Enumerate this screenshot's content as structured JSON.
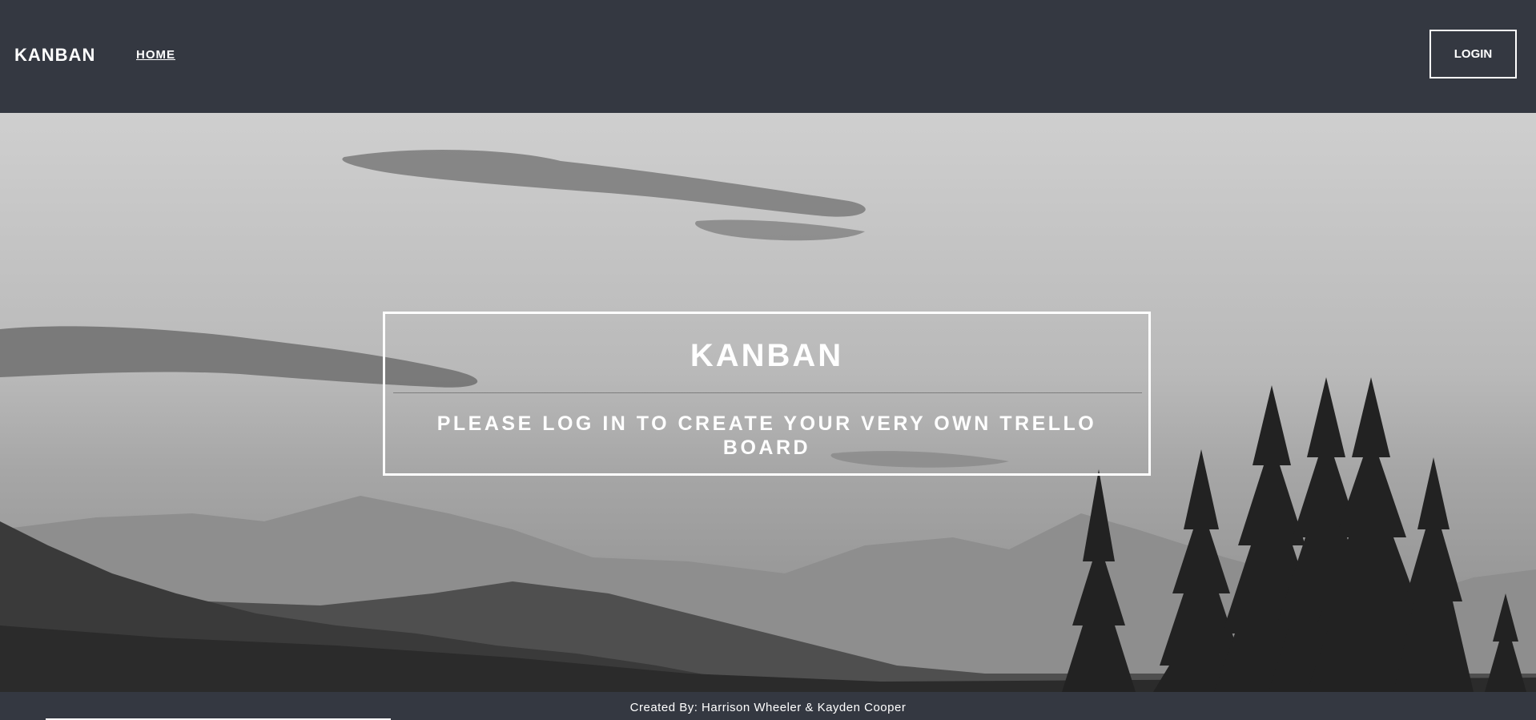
{
  "navbar": {
    "brand": "KANBAN",
    "home_link": "HOME",
    "login_button": "LOGIN"
  },
  "hero": {
    "title": "KANBAN",
    "subtitle": "PLEASE LOG IN TO CREATE YOUR VERY OWN TRELLO BOARD",
    "background_image": "grayscale-mountain-landscape-with-pine-trees"
  },
  "footer": {
    "credits": "Created By: Harrison Wheeler & Kayden Cooper"
  },
  "colors": {
    "navbar_bg": "#343841",
    "text": "#ffffff"
  }
}
